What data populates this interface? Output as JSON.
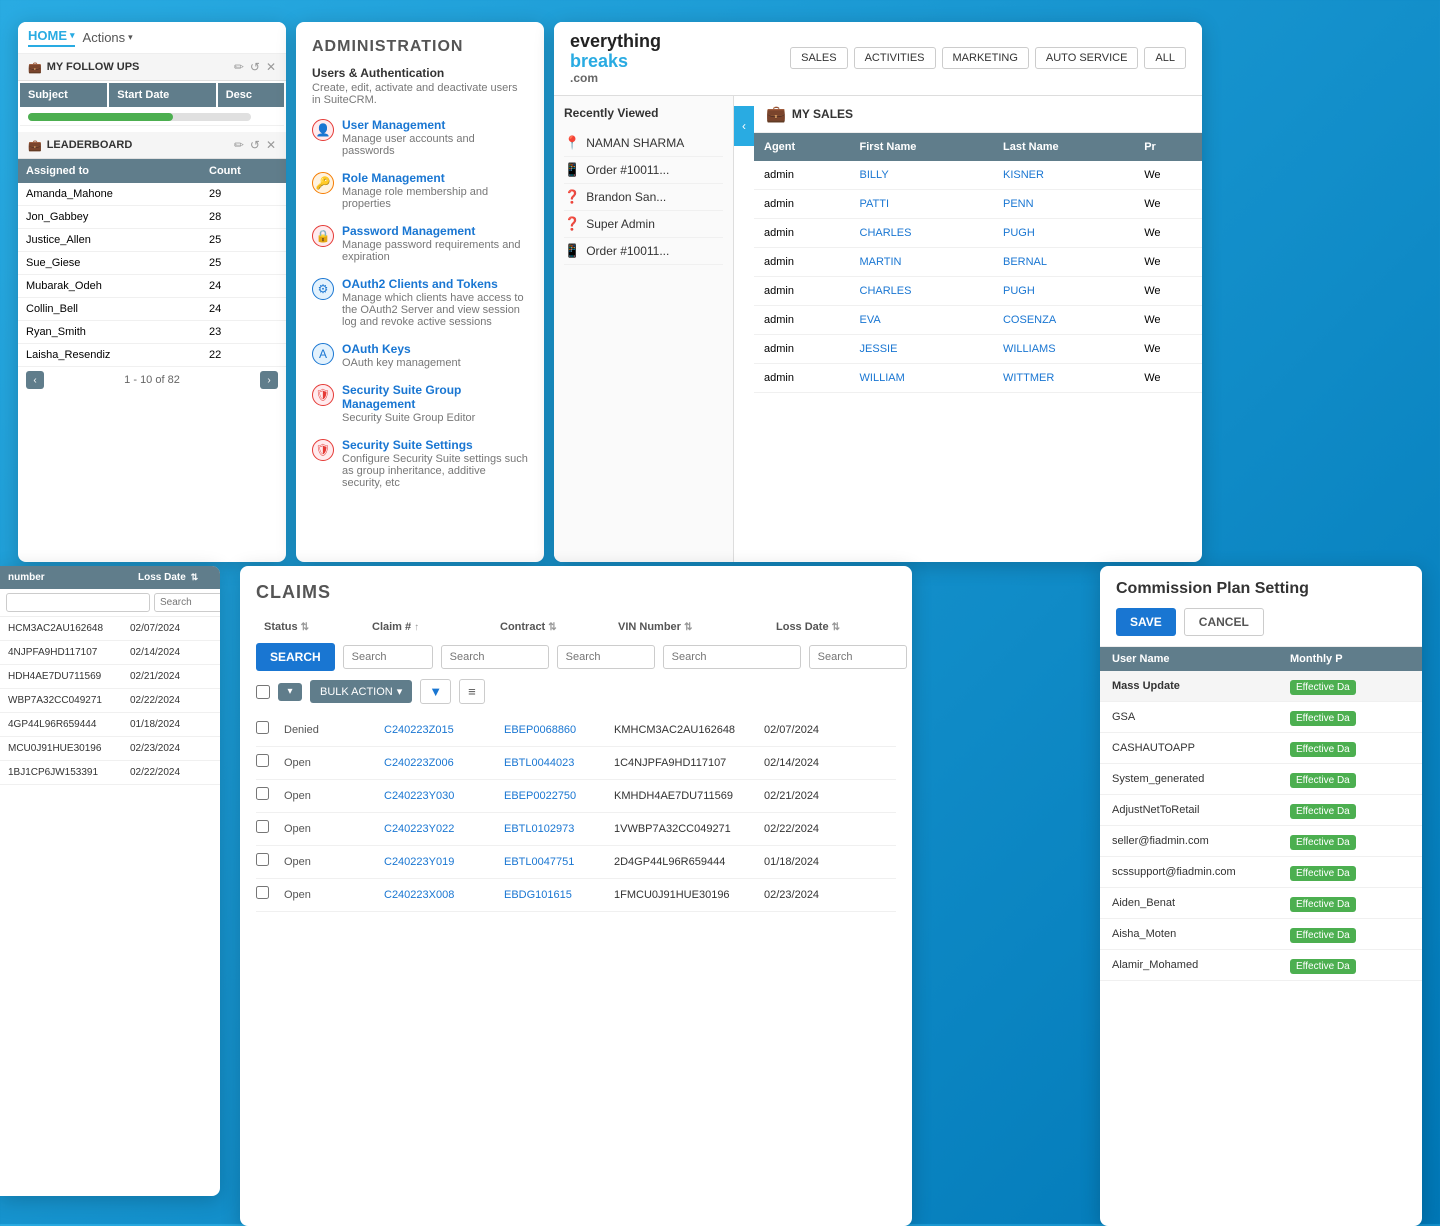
{
  "panel_followup": {
    "tab_home": "HOME",
    "tab_actions": "Actions",
    "section_followup": "MY FOLLOW UPS",
    "section_leaderboard": "LEADERBOARD",
    "follow_columns": [
      "Subject",
      "Start Date",
      "Desc"
    ],
    "leader_columns": [
      "Assigned to",
      "Count"
    ],
    "pagination_label": "1 - 10 of 82",
    "leaderboard_rows": [
      {
        "assigned": "Amanda_Mahone",
        "count": "29"
      },
      {
        "assigned": "Jon_Gabbey",
        "count": "28"
      },
      {
        "assigned": "Justice_Allen",
        "count": "25"
      },
      {
        "assigned": "Sue_Giese",
        "count": "25"
      },
      {
        "assigned": "Mubarak_Odeh",
        "count": "24"
      },
      {
        "assigned": "Collin_Bell",
        "count": "24"
      },
      {
        "assigned": "Ryan_Smith",
        "count": "23"
      },
      {
        "assigned": "Laisha_Resendiz",
        "count": "22"
      }
    ]
  },
  "panel_admin": {
    "title": "ADMINISTRATION",
    "section_title": "Users & Authentication",
    "section_desc": "Create, edit, activate and deactivate users in SuiteCRM.",
    "items": [
      {
        "label": "User Management",
        "desc": "Manage user accounts and passwords",
        "icon": "👤",
        "icon_class": "icon-red"
      },
      {
        "label": "Role Management",
        "desc": "Manage role membership and properties",
        "icon": "🔑",
        "icon_class": "icon-orange"
      },
      {
        "label": "Password Management",
        "desc": "Manage password requirements and expiration",
        "icon": "🔒",
        "icon_class": "icon-red"
      },
      {
        "label": "OAuth2 Clients and Tokens",
        "desc": "Manage which clients have access to the OAuth2 Server and view session log and revoke active sessions",
        "icon": "⚙",
        "icon_class": "icon-blue-outline"
      },
      {
        "label": "OAuth Keys",
        "desc": "OAuth key management",
        "icon": "A",
        "icon_class": "icon-blue-outline"
      },
      {
        "label": "Security Suite Group Management",
        "desc": "Security Suite Group Editor",
        "icon": "🛡",
        "icon_class": "icon-red"
      },
      {
        "label": "Security Suite Settings",
        "desc": "Configure Security Suite settings such as group inheritance, additive security, etc",
        "icon": "🛡",
        "icon_class": "icon-red"
      }
    ]
  },
  "panel_sales": {
    "logo_everything": "everything",
    "logo_breaks": "breaks",
    "logo_com": ".com",
    "nav_items": [
      "SALES",
      "ACTIVITIES",
      "MARKETING",
      "AUTO SERVICE",
      "ALL"
    ],
    "recently_viewed_title": "Recently Viewed",
    "recently_viewed": [
      {
        "icon": "📍",
        "label": "NAMAN SHARMA"
      },
      {
        "icon": "📱",
        "label": "Order #10011..."
      },
      {
        "icon": "❓",
        "label": "Brandon San..."
      },
      {
        "icon": "❓",
        "label": "Super Admin"
      },
      {
        "icon": "📱",
        "label": "Order #10011..."
      }
    ],
    "my_sales_title": "MY SALES",
    "sales_columns": [
      "Agent",
      "First Name",
      "Last Name",
      "Pr"
    ],
    "sales_rows": [
      {
        "agent": "admin",
        "first": "BILLY",
        "last": "KISNER",
        "pr": "We"
      },
      {
        "agent": "admin",
        "first": "PATTI",
        "last": "PENN",
        "pr": "We"
      },
      {
        "agent": "admin",
        "first": "CHARLES",
        "last": "PUGH",
        "pr": "We"
      },
      {
        "agent": "admin",
        "first": "MARTIN",
        "last": "BERNAL",
        "pr": "We"
      },
      {
        "agent": "admin",
        "first": "CHARLES",
        "last": "PUGH",
        "pr": "We"
      },
      {
        "agent": "admin",
        "first": "EVA",
        "last": "COSENZA",
        "pr": "We"
      },
      {
        "agent": "admin",
        "first": "JESSIE",
        "last": "WILLIAMS",
        "pr": "We"
      },
      {
        "agent": "admin",
        "first": "WILLIAM",
        "last": "WITTMER",
        "pr": "We"
      }
    ]
  },
  "panel_vin": {
    "col1": "number",
    "col2": "Loss Date",
    "search_placeholder1": "",
    "search_placeholder2": "Search",
    "rows": [
      {
        "num": "HCM3AC2AU162648",
        "date": "02/07/2024"
      },
      {
        "num": "4NJPFA9HD117107",
        "date": "02/14/2024"
      },
      {
        "num": "HDH4AE7DU711569",
        "date": "02/21/2024"
      },
      {
        "num": "WBP7A32CC049271",
        "date": "02/22/2024"
      },
      {
        "num": "4GP44L96R659444",
        "date": "01/18/2024"
      },
      {
        "num": "MCU0J91HUE30196",
        "date": "02/23/2024"
      },
      {
        "num": "1BJ1CP6JW153391",
        "date": "02/22/2024"
      }
    ]
  },
  "panel_claims": {
    "title": "CLAIMS",
    "search_btn": "SEARCH",
    "columns": [
      {
        "label": "Status",
        "key": "status"
      },
      {
        "label": "Claim #",
        "key": "claim"
      },
      {
        "label": "Contract",
        "key": "contract"
      },
      {
        "label": "VIN Number",
        "key": "vin"
      },
      {
        "label": "Loss Date",
        "key": "loss"
      }
    ],
    "search_placeholders": [
      "Search",
      "Search",
      "Search",
      "Search",
      "Search"
    ],
    "bulk_action": "BULK ACTION",
    "rows": [
      {
        "status": "Denied",
        "claim": "C240223Z015",
        "contract": "EBEP0068860",
        "vin": "KMHCM3AC2AU162648",
        "loss": "02/07/2024"
      },
      {
        "status": "Open",
        "claim": "C240223Z006",
        "contract": "EBTL0044023",
        "vin": "1C4NJPFA9HD117107",
        "loss": "02/14/2024"
      },
      {
        "status": "Open",
        "claim": "C240223Y030",
        "contract": "EBEP0022750",
        "vin": "KMHDH4AE7DU711569",
        "loss": "02/21/2024"
      },
      {
        "status": "Open",
        "claim": "C240223Y022",
        "contract": "EBTL0102973",
        "vin": "1VWBP7A32CC049271",
        "loss": "02/22/2024"
      },
      {
        "status": "Open",
        "claim": "C240223Y019",
        "contract": "EBTL0047751",
        "vin": "2D4GP44L96R659444",
        "loss": "01/18/2024"
      },
      {
        "status": "Open",
        "claim": "C240223X008",
        "contract": "EBDG101615",
        "vin": "1FMCU0J91HUE30196",
        "loss": "02/23/2024"
      }
    ]
  },
  "panel_commission": {
    "title": "Commission Plan Setting",
    "save_label": "SAVE",
    "cancel_label": "CANCEL",
    "table_title": "Commission Plan Setting",
    "col_username": "User Name",
    "col_monthly": "Monthly P",
    "rows": [
      {
        "username": "Mass Update",
        "monthly": "Effective Da",
        "is_mass_update": true
      },
      {
        "username": "GSA",
        "monthly": "Effective Da",
        "is_mass_update": false
      },
      {
        "username": "CASHAUTOAPP",
        "monthly": "Effective Da",
        "is_mass_update": false
      },
      {
        "username": "System_generated",
        "monthly": "Effective Da",
        "is_mass_update": false
      },
      {
        "username": "AdjustNetToRetail",
        "monthly": "Effective Da",
        "is_mass_update": false
      },
      {
        "username": "seller@fiadmin.com",
        "monthly": "Effective Da",
        "is_mass_update": false
      },
      {
        "username": "scssupport@fiadmin.com",
        "monthly": "Effective Da",
        "is_mass_update": false
      },
      {
        "username": "Aiden_Benat",
        "monthly": "Effective Da",
        "is_mass_update": false
      },
      {
        "username": "Aisha_Moten",
        "monthly": "Effective Da",
        "is_mass_update": false
      },
      {
        "username": "Alamir_Mohamed",
        "monthly": "Effective Da",
        "is_mass_update": false
      }
    ]
  }
}
